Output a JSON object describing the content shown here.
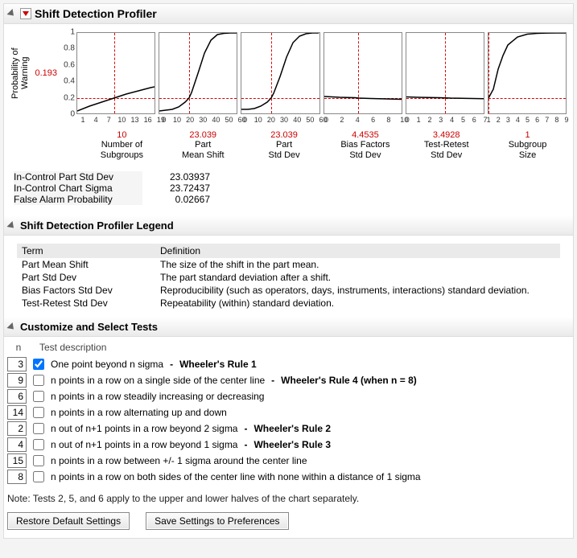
{
  "sections": {
    "profiler_title": "Shift Detection Profiler",
    "legend_title": "Shift Detection Profiler Legend",
    "tests_title": "Customize and Select Tests"
  },
  "yaxis": {
    "label": "Probability of\nWarning",
    "highlight_value": "0.193",
    "ticks": [
      "0",
      "0.2",
      "0.4",
      "0.6",
      "0.8",
      "1"
    ]
  },
  "chart_data": [
    {
      "name": "Number of Subgroups",
      "type": "line",
      "xticks": [
        "1",
        "4",
        "7",
        "10",
        "13",
        "16",
        "19"
      ],
      "xlim": [
        1,
        20
      ],
      "ylim": [
        0,
        1
      ],
      "x_marker": 10,
      "y_marker": 0.193,
      "points": [
        [
          1,
          0.03
        ],
        [
          4,
          0.09
        ],
        [
          7,
          0.14
        ],
        [
          10,
          0.19
        ],
        [
          13,
          0.24
        ],
        [
          16,
          0.28
        ],
        [
          19,
          0.32
        ],
        [
          20,
          0.33
        ]
      ],
      "value": "10",
      "label": "Number of\nSubgroups"
    },
    {
      "name": "Part Mean Shift",
      "type": "line",
      "xticks": [
        "0",
        "10",
        "20",
        "30",
        "40",
        "50",
        "60"
      ],
      "xlim": [
        0,
        60
      ],
      "ylim": [
        0,
        1
      ],
      "x_marker": 23.039,
      "y_marker": 0.193,
      "points": [
        [
          0,
          0.03
        ],
        [
          5,
          0.04
        ],
        [
          10,
          0.05
        ],
        [
          15,
          0.08
        ],
        [
          20,
          0.14
        ],
        [
          23,
          0.19
        ],
        [
          25,
          0.26
        ],
        [
          30,
          0.5
        ],
        [
          35,
          0.75
        ],
        [
          40,
          0.91
        ],
        [
          45,
          0.98
        ],
        [
          50,
          0.995
        ],
        [
          55,
          1.0
        ],
        [
          60,
          1.0
        ]
      ],
      "value": "23.039",
      "label": "Part\nMean Shift"
    },
    {
      "name": "Part Std Dev",
      "type": "line",
      "xticks": [
        "0",
        "10",
        "20",
        "30",
        "40",
        "50",
        "60"
      ],
      "xlim": [
        0,
        60
      ],
      "ylim": [
        0,
        1
      ],
      "x_marker": 23.039,
      "y_marker": 0.193,
      "points": [
        [
          0,
          0.05
        ],
        [
          5,
          0.05
        ],
        [
          10,
          0.06
        ],
        [
          15,
          0.09
        ],
        [
          20,
          0.14
        ],
        [
          23,
          0.19
        ],
        [
          25,
          0.25
        ],
        [
          30,
          0.46
        ],
        [
          35,
          0.7
        ],
        [
          40,
          0.88
        ],
        [
          45,
          0.96
        ],
        [
          50,
          0.99
        ],
        [
          55,
          1.0
        ],
        [
          60,
          1.0
        ]
      ],
      "value": "23.039",
      "label": "Part\nStd Dev"
    },
    {
      "name": "Bias Factors Std Dev",
      "type": "line",
      "xticks": [
        "0",
        "2",
        "4",
        "6",
        "8",
        "10"
      ],
      "xlim": [
        0,
        10
      ],
      "ylim": [
        0,
        1
      ],
      "x_marker": 4.4535,
      "y_marker": 0.193,
      "points": [
        [
          0,
          0.21
        ],
        [
          2,
          0.2
        ],
        [
          4,
          0.195
        ],
        [
          4.45,
          0.19
        ],
        [
          6,
          0.185
        ],
        [
          8,
          0.18
        ],
        [
          10,
          0.175
        ]
      ],
      "value": "4.4535",
      "label": "Bias Factors\nStd Dev"
    },
    {
      "name": "Test-Retest Std Dev",
      "type": "line",
      "xticks": [
        "0",
        "1",
        "2",
        "3",
        "4",
        "5",
        "6",
        "7"
      ],
      "xlim": [
        0,
        7
      ],
      "ylim": [
        0,
        1
      ],
      "x_marker": 3.4928,
      "y_marker": 0.193,
      "points": [
        [
          0,
          0.205
        ],
        [
          1,
          0.2
        ],
        [
          2,
          0.198
        ],
        [
          3,
          0.195
        ],
        [
          3.49,
          0.193
        ],
        [
          4,
          0.19
        ],
        [
          5,
          0.188
        ],
        [
          6,
          0.185
        ],
        [
          7,
          0.183
        ]
      ],
      "value": "3.4928",
      "label": "Test-Retest\nStd Dev"
    },
    {
      "name": "Subgroup Size",
      "type": "line",
      "xticks": [
        "1",
        "2",
        "3",
        "4",
        "5",
        "6",
        "7",
        "8",
        "9"
      ],
      "xlim": [
        1,
        9
      ],
      "ylim": [
        0,
        1
      ],
      "x_marker": 1,
      "y_marker": 0.193,
      "points": [
        [
          1,
          0.19
        ],
        [
          1.5,
          0.3
        ],
        [
          2,
          0.55
        ],
        [
          2.5,
          0.72
        ],
        [
          3,
          0.85
        ],
        [
          4,
          0.95
        ],
        [
          5,
          0.985
        ],
        [
          6,
          0.995
        ],
        [
          7,
          0.999
        ],
        [
          8,
          1.0
        ],
        [
          9,
          1.0
        ]
      ],
      "value": "1",
      "label": "Subgroup\nSize"
    }
  ],
  "stats": [
    {
      "label": "In-Control Part Std Dev",
      "value": "23.03937"
    },
    {
      "label": "In-Control Chart Sigma",
      "value": "23.72437"
    },
    {
      "label": "False Alarm Probability",
      "value": "0.02667"
    }
  ],
  "legend": {
    "headers": {
      "term": "Term",
      "definition": "Definition"
    },
    "rows": [
      {
        "term": "Part Mean Shift",
        "def": "The size of the shift in the part mean."
      },
      {
        "term": "Part Std Dev",
        "def": "The part standard deviation after a shift."
      },
      {
        "term": "Bias Factors Std Dev",
        "def": "Reproducibility (such as operators, days, instruments, interactions) standard deviation."
      },
      {
        "term": "Test-Retest Std Dev",
        "def": "Repeatability (within) standard deviation."
      }
    ]
  },
  "tests": {
    "col_n": "n",
    "col_desc": "Test description",
    "rows": [
      {
        "n": "3",
        "checked": true,
        "desc": "One point beyond n sigma",
        "suffix": "Wheeler's Rule 1"
      },
      {
        "n": "9",
        "checked": false,
        "desc": "n points in a row on a single side of the center line",
        "suffix": "Wheeler's Rule 4 (when n = 8)"
      },
      {
        "n": "6",
        "checked": false,
        "desc": "n points in a row steadily increasing or decreasing",
        "suffix": ""
      },
      {
        "n": "14",
        "checked": false,
        "desc": "n points in a row alternating up and down",
        "suffix": ""
      },
      {
        "n": "2",
        "checked": false,
        "desc": "n out of n+1 points in a row beyond 2 sigma",
        "suffix": "Wheeler's Rule 2"
      },
      {
        "n": "4",
        "checked": false,
        "desc": "n out of n+1 points in a row beyond 1 sigma",
        "suffix": "Wheeler's Rule 3"
      },
      {
        "n": "15",
        "checked": false,
        "desc": "n points in a row between +/- 1 sigma around the center line",
        "suffix": ""
      },
      {
        "n": "8",
        "checked": false,
        "desc": "n points in a row on both sides of the center line with none within a distance of 1 sigma",
        "suffix": ""
      }
    ],
    "note": "Note: Tests 2, 5, and 6 apply to the upper and lower halves of the chart separately."
  },
  "buttons": {
    "restore": "Restore Default Settings",
    "save": "Save Settings to Preferences"
  }
}
